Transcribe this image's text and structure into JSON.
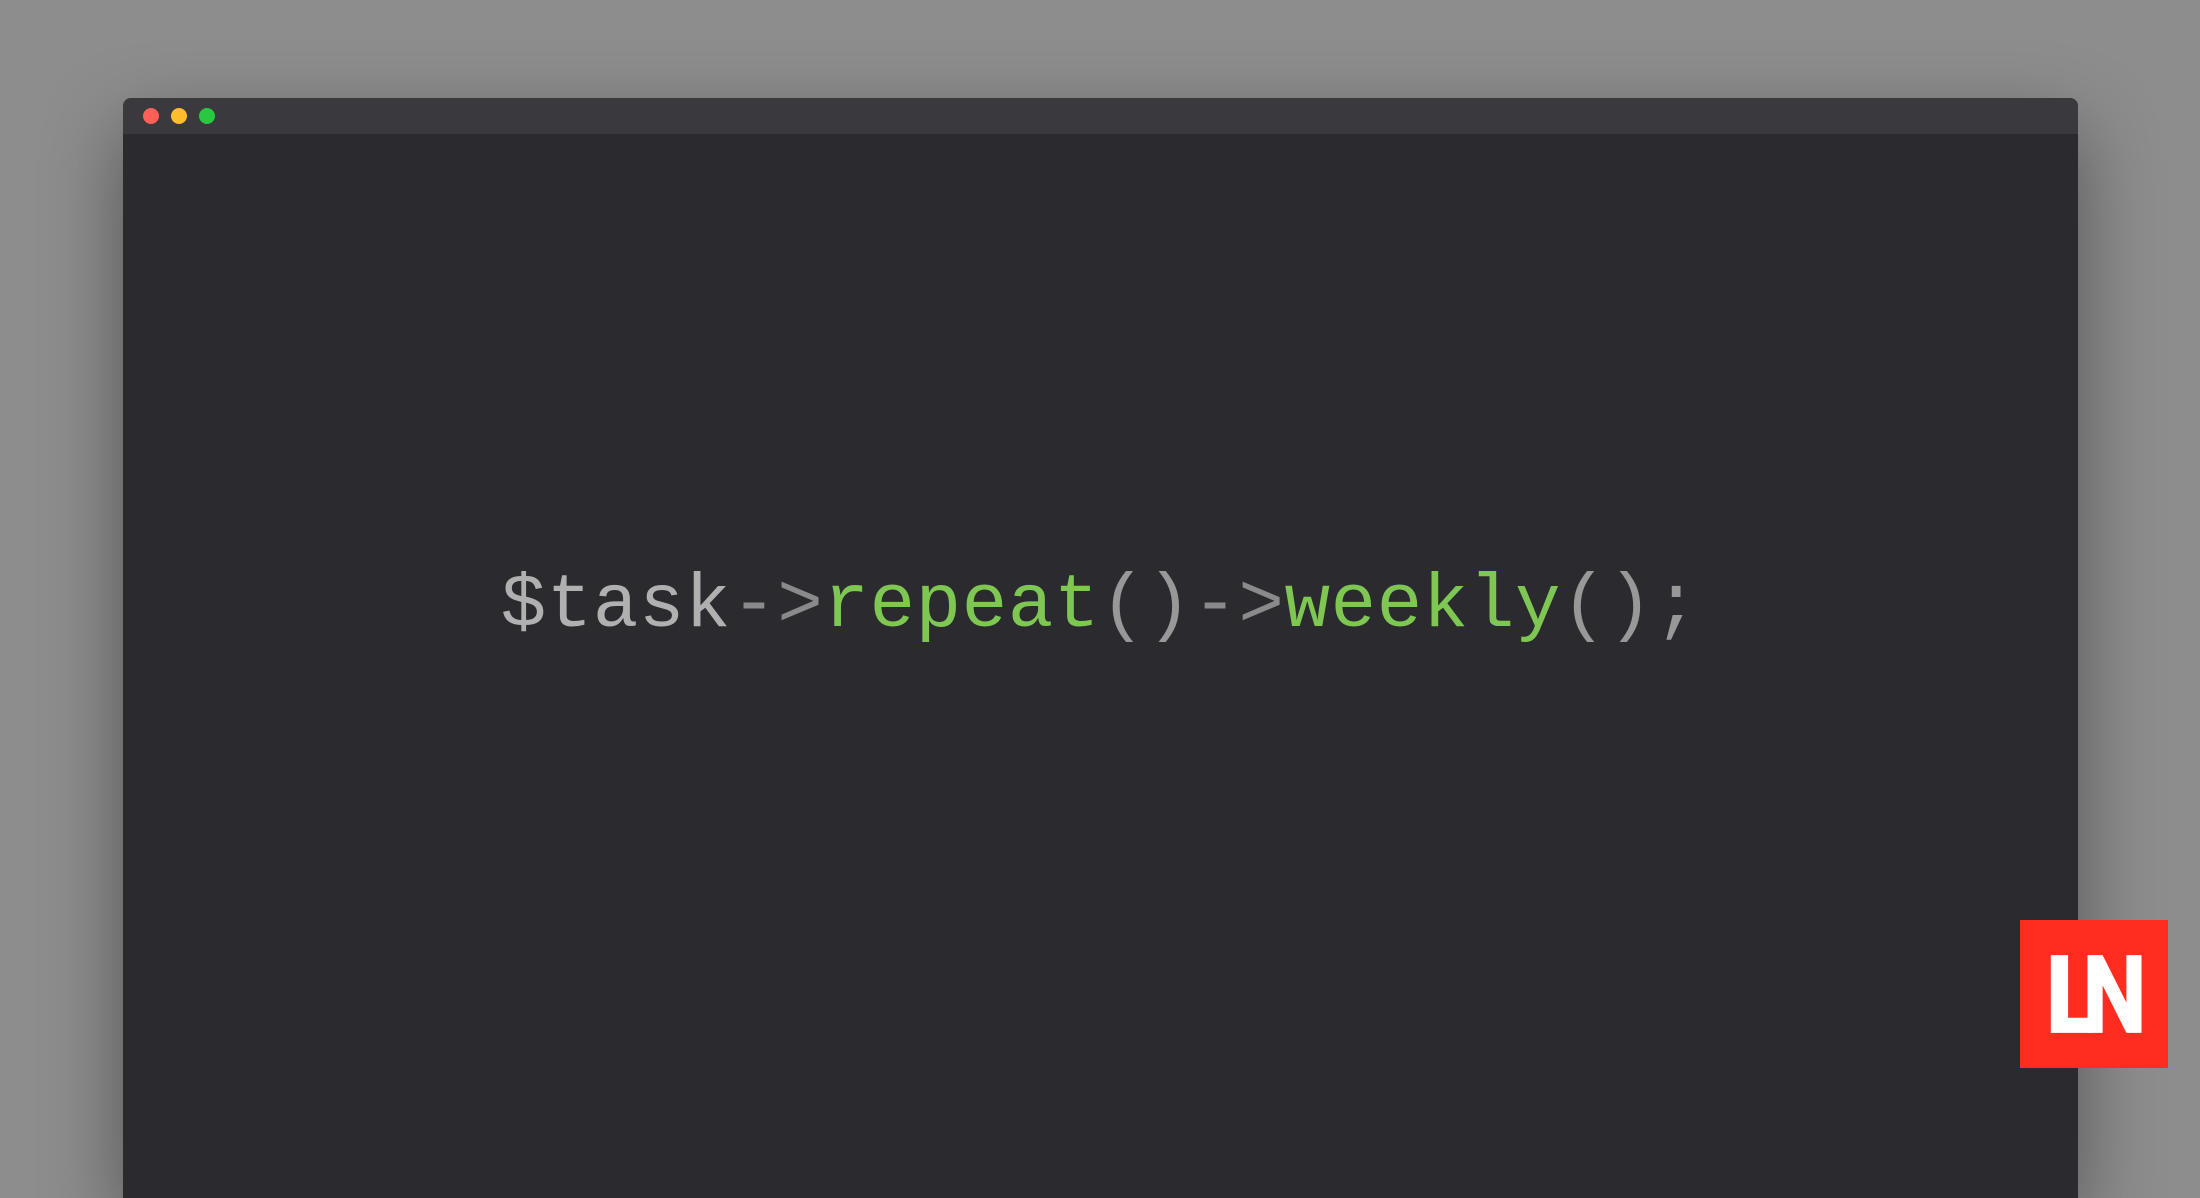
{
  "code": {
    "tokens": {
      "t0": "$task",
      "t1": "->",
      "t2": "repeat",
      "t3": "()",
      "t4": "->",
      "t5": "weekly",
      "t6": "()",
      "t7": ";"
    }
  },
  "traffic_lights": {
    "red": "#ff5f57",
    "yellow": "#febc2e",
    "green": "#28c840"
  },
  "logo_text": "LN",
  "colors": {
    "background": "#8d8d8d",
    "editor_bg": "#2b2a2e",
    "titlebar_bg": "#3a393e",
    "variable": "#b0b0b0",
    "arrow": "#8a8a8a",
    "method": "#7ec752",
    "paren": "#989898",
    "logo_bg": "#ff2d20"
  }
}
